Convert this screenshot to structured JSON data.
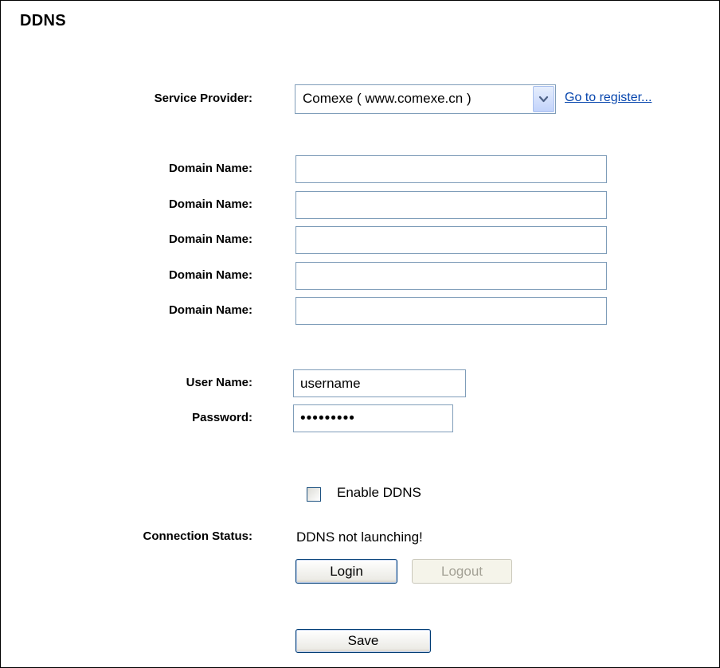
{
  "page_title": "DDNS",
  "service_provider": {
    "label": "Service Provider:",
    "selected": "Comexe ( www.comexe.cn )",
    "register_link": "Go to register..."
  },
  "domains": {
    "label": "Domain Name:",
    "values": [
      "",
      "",
      "",
      "",
      ""
    ]
  },
  "user_name": {
    "label": "User Name:",
    "value": "username"
  },
  "password": {
    "label": "Password:",
    "value": "•••••••••"
  },
  "enable_ddns": {
    "label": "Enable DDNS",
    "checked": false
  },
  "connection_status": {
    "label": "Connection Status:",
    "value": "DDNS not launching!"
  },
  "buttons": {
    "login": "Login",
    "logout": "Logout",
    "save": "Save"
  },
  "icons": {
    "dropdown": "chevron-down-icon",
    "checkbox": "checkbox-unchecked-icon"
  }
}
